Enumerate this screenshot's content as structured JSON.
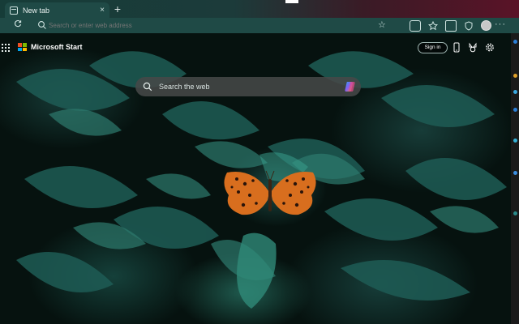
{
  "browser": {
    "tab": {
      "title": "New tab",
      "close_glyph": "×"
    },
    "new_tab_glyph": "+",
    "address": {
      "placeholder": "Search or enter web address"
    },
    "more_glyph": "···",
    "accent": "#1f4a46"
  },
  "page": {
    "brand": {
      "name": "Microsoft Start"
    },
    "signin_label": "Sign in",
    "search": {
      "placeholder": "Search the web"
    },
    "icons": [
      "apps-icon",
      "microsoft-logo",
      "phone-icon",
      "rewards-icon",
      "settings-icon",
      "search-icon",
      "copilot-icon"
    ],
    "background": "dark nettle leaves with orange fritillary butterfly"
  },
  "colors": {
    "ms_red": "#f25022",
    "ms_green": "#7fba00",
    "ms_blue": "#00a4ef",
    "ms_yellow": "#ffb900",
    "butterfly": "#e07a22"
  }
}
